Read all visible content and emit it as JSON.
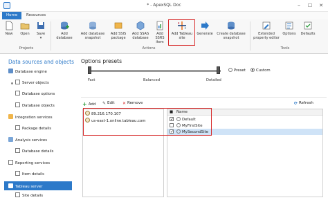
{
  "window": {
    "title": "* - ApexSQL Doc",
    "minimize": "–",
    "maximize": "☐",
    "close": "✕"
  },
  "tabs": [
    {
      "label": "Home"
    },
    {
      "label": "Resources"
    }
  ],
  "ribbon": {
    "buttons": [
      {
        "label": "New"
      },
      {
        "label": "Open"
      },
      {
        "label": "Save"
      },
      {
        "label": "Add database"
      },
      {
        "label": "Add database snapshot"
      },
      {
        "label": "Add SSIS package"
      },
      {
        "label": "Add SSAS database"
      },
      {
        "label": "Add SSRS item"
      },
      {
        "label": "Add Tableau site"
      },
      {
        "label": "Generate"
      },
      {
        "label": "Create database snapshot"
      },
      {
        "label": "Extended property editor"
      },
      {
        "label": "Options"
      },
      {
        "label": "Defaults"
      }
    ],
    "groups": {
      "projects": "Projects",
      "actions": "Actions",
      "tools": "Tools"
    }
  },
  "sidebar": {
    "title": "Data sources and objects",
    "items": [
      {
        "label": "Database engine"
      },
      {
        "label": "Server objects"
      },
      {
        "label": "Database options"
      },
      {
        "label": "Database objects"
      },
      {
        "label": "Integration services"
      },
      {
        "label": "Package details"
      },
      {
        "label": "Analysis services"
      },
      {
        "label": "Database details"
      },
      {
        "label": "Reporting services"
      },
      {
        "label": "Item details"
      },
      {
        "label": "Tableau server"
      },
      {
        "label": "Site details"
      }
    ]
  },
  "presets": {
    "title": "Options presets",
    "levels": [
      "Fast",
      "Balanced",
      "Detailed"
    ],
    "radio_preset": "Preset",
    "radio_custom": "Custom",
    "selected": "Custom"
  },
  "toolbar": {
    "add": "Add",
    "edit": "Edit",
    "remove": "Remove",
    "refresh": "Refresh"
  },
  "servers": [
    "89.216.170.107",
    "us-east-1.online.tableau.com"
  ],
  "sites": {
    "header": "Name",
    "rows": [
      {
        "name": "Default",
        "checked": true
      },
      {
        "name": "MyFirstSite",
        "checked": false
      },
      {
        "name": "MySecondSite",
        "checked": true
      }
    ]
  },
  "colors": {
    "accent": "#2c79c9",
    "highlight": "#d72b2b"
  }
}
